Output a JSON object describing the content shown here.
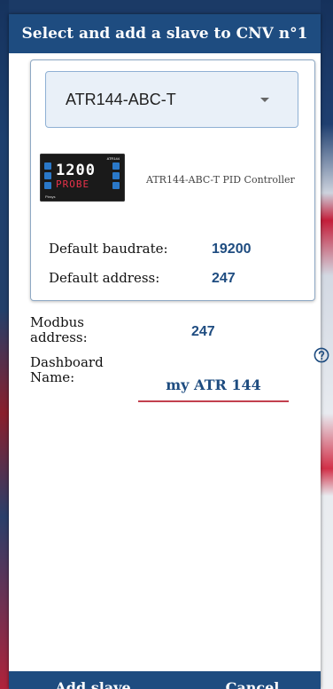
{
  "dialog": {
    "title": "Select and add a slave to CNV n°1"
  },
  "device_select": {
    "value": "ATR144-ABC-T",
    "icon": "chevron-down-icon"
  },
  "device_info": {
    "display_top": "1200",
    "display_bottom": "PROBE",
    "description": "ATR144-ABC-T PID Controller",
    "baudrate_label": "Default baudrate:",
    "baudrate_value": "19200",
    "address_label": "Default  address:",
    "address_value": "247"
  },
  "form": {
    "modbus_label_line1": "Modbus",
    "modbus_label_line2": "address:",
    "modbus_value": "247",
    "dashboard_label_line1": "Dashboard",
    "dashboard_label_line2": "Name:",
    "dashboard_name_value": "my ATR 144",
    "help_icon": "help-circle-icon"
  },
  "footer": {
    "add_label": "Add slave",
    "cancel_label": "Cancel"
  },
  "colors": {
    "primary": "#1e4c80",
    "accent_underline": "#c2404e"
  }
}
